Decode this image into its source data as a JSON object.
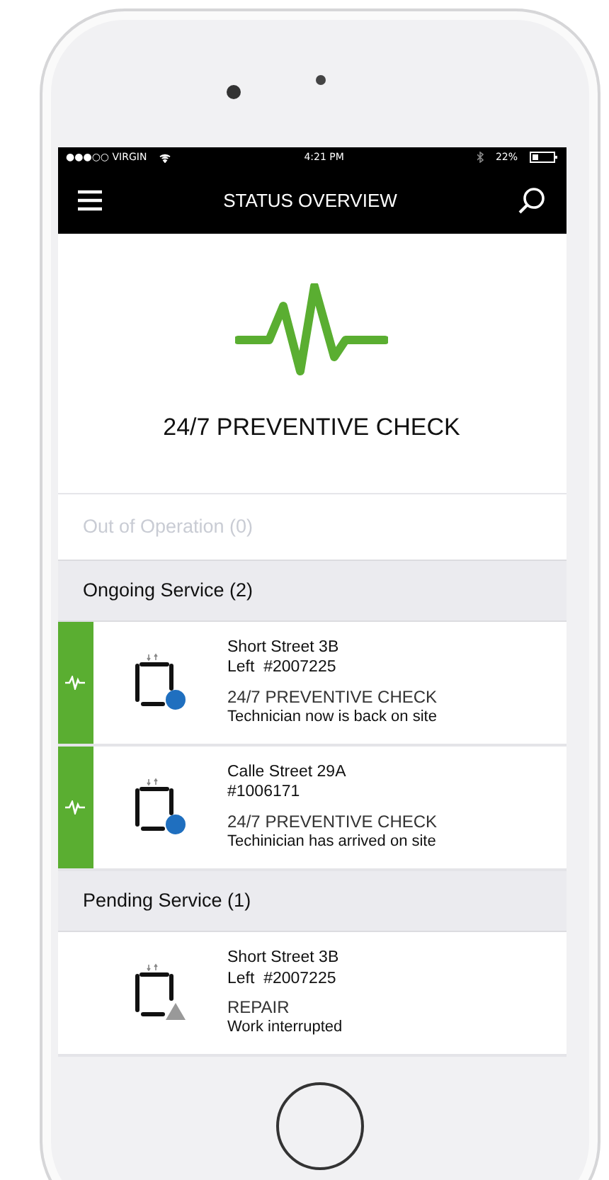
{
  "status_bar": {
    "carrier": "●●●○○ VIRGIN",
    "time": "4:21 PM",
    "battery": "22%"
  },
  "nav": {
    "title": "STATUS OVERVIEW"
  },
  "hero": {
    "title": "24/7 PREVENTIVE CHECK"
  },
  "sections": [
    {
      "title": "Out of Operation (0)",
      "disabled": true
    },
    {
      "title": "Ongoing Service (2)",
      "disabled": false,
      "items": [
        {
          "address": "Short Street 3B",
          "ref": "Left  #2007225",
          "service": "24/7 PREVENTIVE CHECK",
          "status": "Technician now is back on site",
          "flagged": true,
          "kind": "dot"
        },
        {
          "address": "Calle Street 29A",
          "ref": "#1006171",
          "service": "24/7 PREVENTIVE CHECK",
          "status": "Techinician has arrived on site",
          "flagged": true,
          "kind": "dot"
        }
      ]
    },
    {
      "title": "Pending Service (1)",
      "disabled": false,
      "items": [
        {
          "address": "Short Street 3B",
          "ref": "Left  #2007225",
          "service": "REPAIR",
          "status": "Work interrupted",
          "flagged": false,
          "kind": "triangle"
        }
      ]
    }
  ]
}
